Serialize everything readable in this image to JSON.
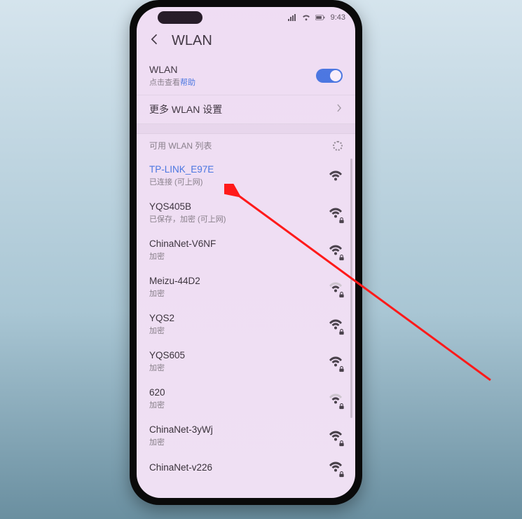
{
  "status": {
    "time": "9:43",
    "battery_icon": "battery",
    "signal_icon": "signal",
    "wifi_icon": "wifi"
  },
  "header": {
    "title": "WLAN"
  },
  "wlanToggle": {
    "title": "WLAN",
    "sub_prefix": "点击查看",
    "sub_link": "帮助",
    "enabled": true
  },
  "moreSettings": {
    "label": "更多 WLAN 设置"
  },
  "availableHeader": {
    "label": "可用 WLAN 列表"
  },
  "networks": [
    {
      "name": "TP-LINK_E97E",
      "sub": "已连接 (可上网)",
      "connected": true,
      "locked": false,
      "strength": 3
    },
    {
      "name": "YQS405B",
      "sub": "已保存，加密 (可上网)",
      "connected": false,
      "locked": true,
      "strength": 3
    },
    {
      "name": "ChinaNet-V6NF",
      "sub": "加密",
      "connected": false,
      "locked": true,
      "strength": 3
    },
    {
      "name": "Meizu-44D2",
      "sub": "加密",
      "connected": false,
      "locked": true,
      "strength": 2
    },
    {
      "name": "YQS2",
      "sub": "加密",
      "connected": false,
      "locked": true,
      "strength": 3
    },
    {
      "name": "YQS605",
      "sub": "加密",
      "connected": false,
      "locked": true,
      "strength": 3
    },
    {
      "name": "620",
      "sub": "加密",
      "connected": false,
      "locked": true,
      "strength": 2
    },
    {
      "name": "ChinaNet-3yWj",
      "sub": "加密",
      "connected": false,
      "locked": true,
      "strength": 3
    },
    {
      "name": "ChinaNet-v226",
      "sub": "",
      "connected": false,
      "locked": true,
      "strength": 3
    }
  ]
}
